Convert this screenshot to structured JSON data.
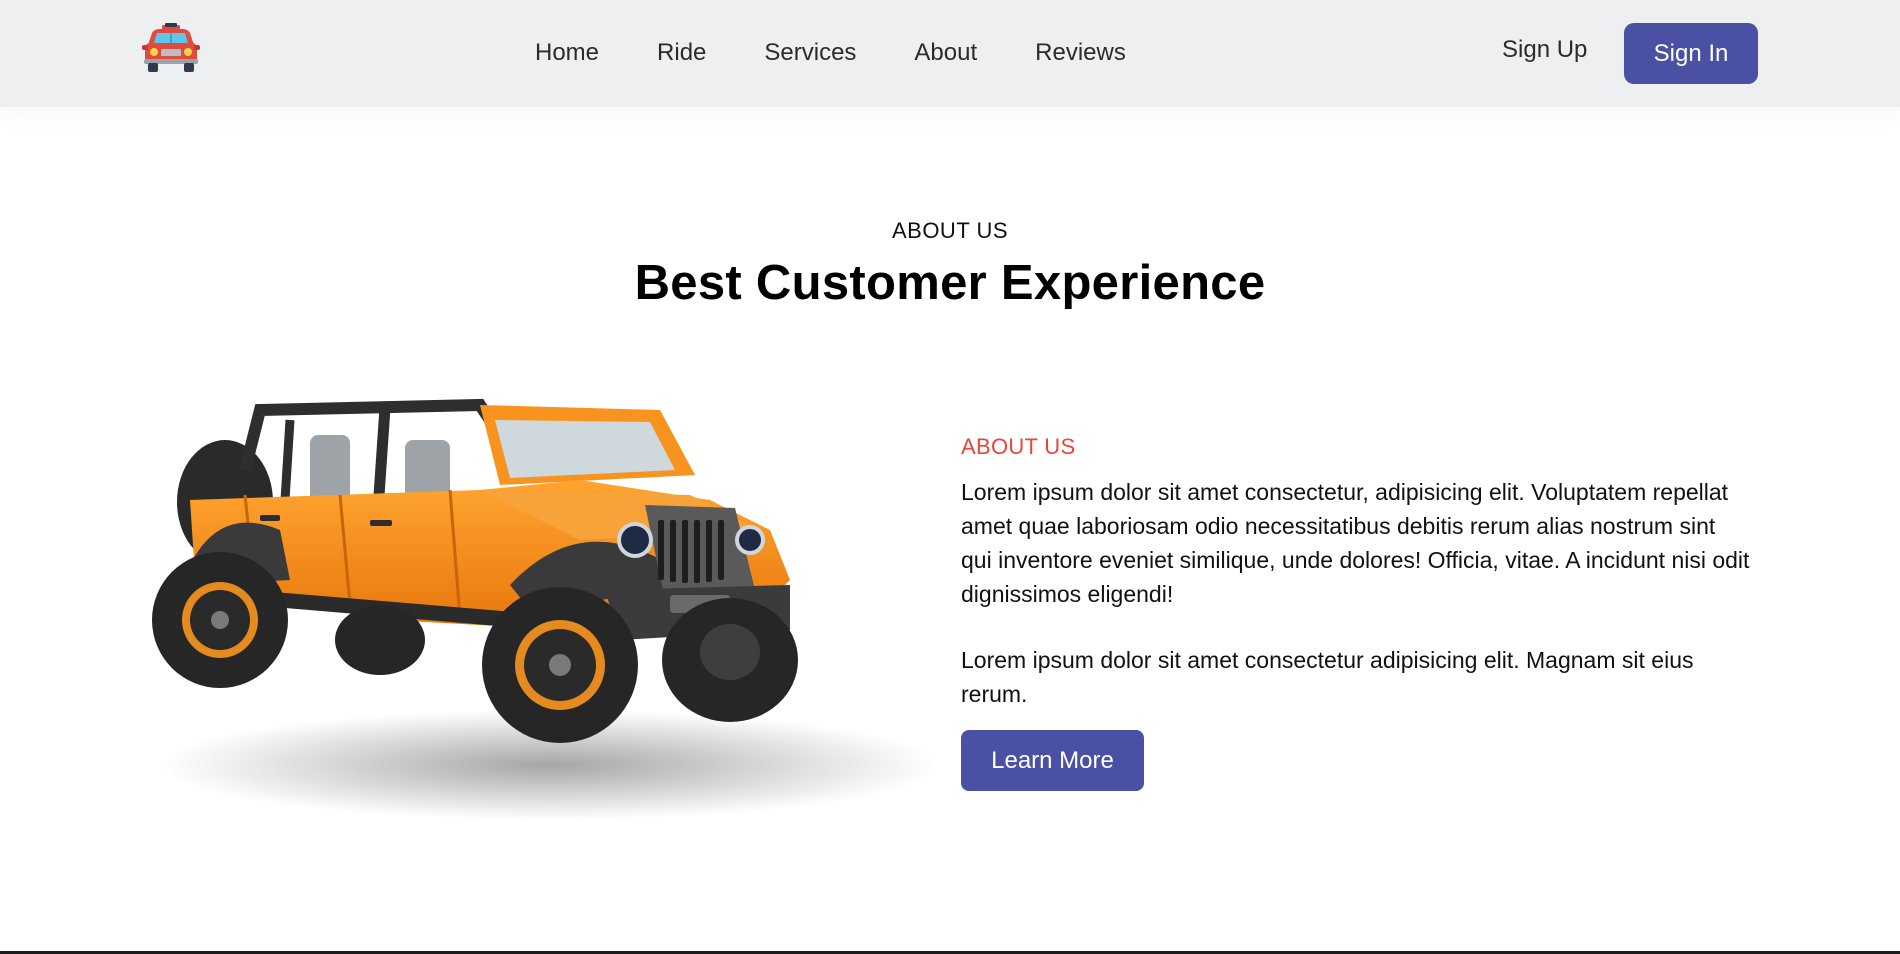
{
  "header": {
    "logo_icon": "car-icon",
    "nav": [
      {
        "label": "Home"
      },
      {
        "label": "Ride"
      },
      {
        "label": "Services"
      },
      {
        "label": "About"
      },
      {
        "label": "Reviews"
      }
    ],
    "signup_label": "Sign Up",
    "signin_label": "Sign In"
  },
  "section": {
    "eyebrow": "ABOUT US",
    "title": "Best Customer Experience"
  },
  "about": {
    "image_icon": "orange-jeep-image",
    "label": "ABOUT US",
    "paragraph_1": "Lorem ipsum dolor sit amet consectetur, adipisicing elit. Voluptatem repellat amet quae laboriosam odio necessitatibus debitis rerum alias nostrum sint qui inventore eveniet similique, unde dolores! Officia, vitae. A incidunt nisi odit dignissimos eligendi!",
    "paragraph_2": "Lorem ipsum dolor sit amet consectetur adipisicing elit. Magnam sit eius rerum.",
    "button_label": "Learn More"
  },
  "colors": {
    "header_bg": "#eeeff1",
    "accent": "#4a51a5",
    "label_red": "#e8453c",
    "car_orange": "#f7931e"
  }
}
